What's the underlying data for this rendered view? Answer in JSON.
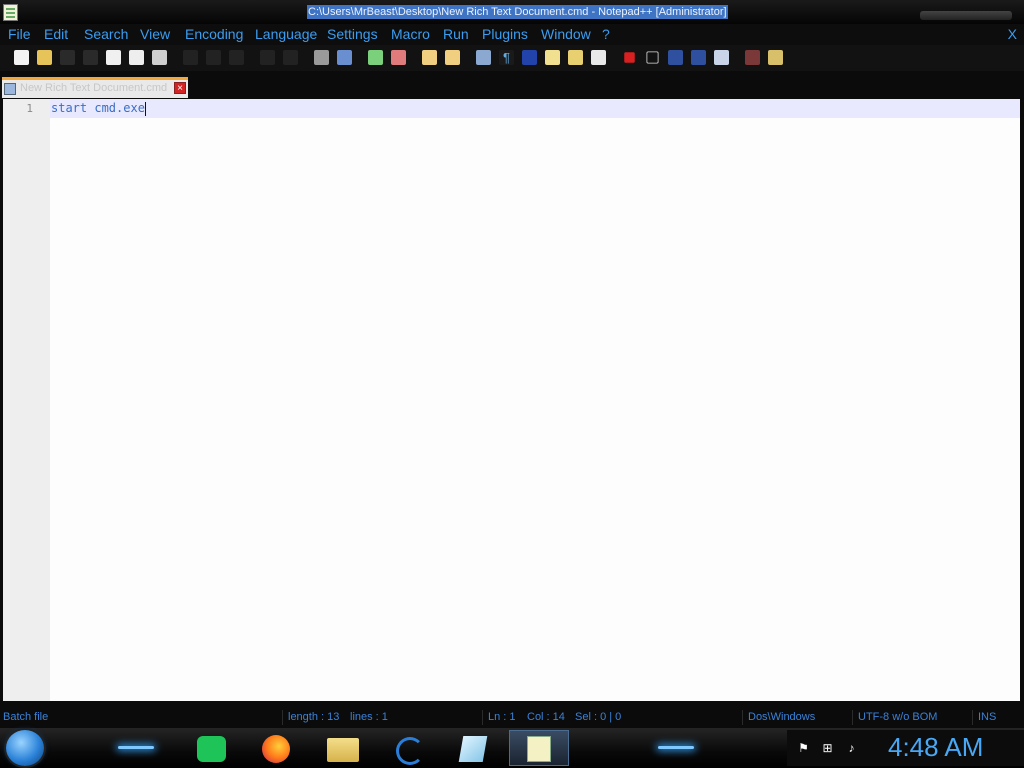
{
  "window": {
    "title": "C:\\Users\\MrBeast\\Desktop\\New Rich Text Document.cmd - Notepad++ [Administrator]",
    "close_label": "X"
  },
  "menu": {
    "file": "File",
    "edit": "Edit",
    "search": "Search",
    "view": "View",
    "encoding": "Encoding",
    "language": "Language",
    "settings": "Settings",
    "macro": "Macro",
    "run": "Run",
    "plugins": "Plugins",
    "window": "Window",
    "help": "?"
  },
  "tab": {
    "label": "New Rich Text Document.cmd",
    "close": "×"
  },
  "editor": {
    "line_number": "1",
    "line_text": "start cmd.exe"
  },
  "status": {
    "file_type": "Batch file",
    "length": "length : 13",
    "lines": "lines : 1",
    "ln": "Ln : 1",
    "col": "Col : 14",
    "sel": "Sel : 0 | 0",
    "eol": "Dos\\Windows",
    "encoding": "UTF-8 w/o BOM",
    "mode": "INS"
  },
  "taskbar": {
    "clock": "4:48 AM"
  },
  "colors": {
    "accent": "#3b9df0",
    "tab_active_border": "#f4a83a",
    "title_highlight": "#3f74c4"
  }
}
